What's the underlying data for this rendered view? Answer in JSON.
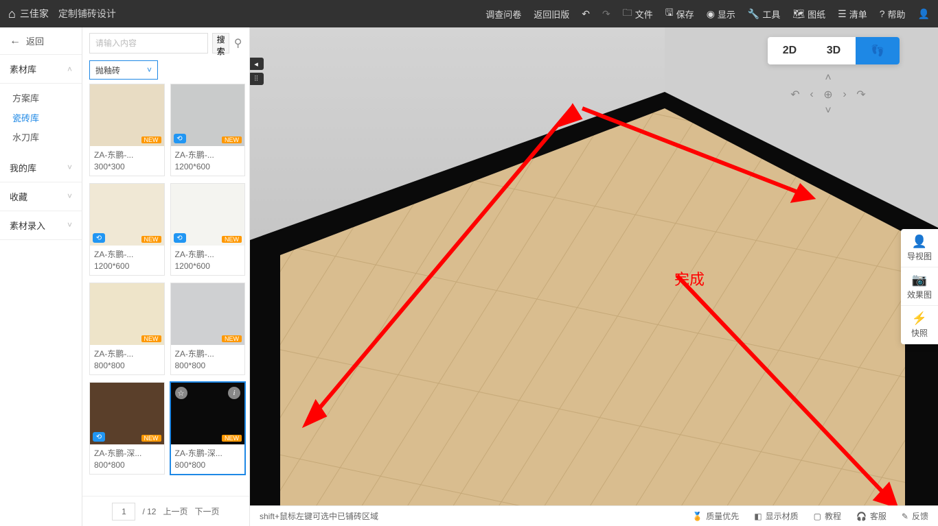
{
  "header": {
    "logo": "三佳家",
    "title": "定制铺砖设计",
    "menu": {
      "survey": "调查问卷",
      "back_old": "返回旧版",
      "file": "文件",
      "save": "保存",
      "display": "显示",
      "tools": "工具",
      "drawings": "图纸",
      "list": "清单",
      "help": "帮助"
    }
  },
  "left": {
    "back": "返回",
    "sections": {
      "material_lib": "素材库",
      "scheme_lib": "方案库",
      "tile_lib": "瓷砖库",
      "waterjet_lib": "水刀库",
      "my_lib": "我的库",
      "favorites": "收藏",
      "material_entry": "素材录入"
    }
  },
  "catalog": {
    "search_placeholder": "请输入内容",
    "search_btn": "搜索",
    "category": "抛釉砖",
    "new_badge": "NEW",
    "items": [
      {
        "name": "ZA-东鹏-...",
        "dim": "300*300",
        "bg": "#e8dcc3",
        "link": false
      },
      {
        "name": "ZA-东鹏-...",
        "dim": "1200*600",
        "bg": "#c9cbcb",
        "link": true
      },
      {
        "name": "ZA-东鹏-...",
        "dim": "1200*600",
        "bg": "#f0e8d5",
        "link": true
      },
      {
        "name": "ZA-东鹏-...",
        "dim": "1200*600",
        "bg": "#f4f4f0",
        "link": true
      },
      {
        "name": "ZA-东鹏-...",
        "dim": "800*800",
        "bg": "#eee4c9",
        "link": false
      },
      {
        "name": "ZA-东鹏-...",
        "dim": "800*800",
        "bg": "#cfd0d2",
        "link": false
      },
      {
        "name": "ZA-东鹏-深...",
        "dim": "800*800",
        "bg": "#5a3f2a",
        "link": true
      },
      {
        "name": "ZA-东鹏-深...",
        "dim": "800*800",
        "bg": "#0a0a0a",
        "link": false,
        "selected": true
      }
    ],
    "pager": {
      "page": "1",
      "total": "/ 12",
      "prev": "上一页",
      "next": "下一页"
    }
  },
  "viewport": {
    "modes": {
      "d2": "2D",
      "d3": "3D"
    },
    "complete": "完成",
    "right_tools": {
      "perspective": "导视图",
      "render": "效果图",
      "snapshot": "快照"
    }
  },
  "status": {
    "hint": "shift+鼠标左键可选中已铺砖区域",
    "quality": "质量优先",
    "show_mat": "显示材质",
    "tutorial": "教程",
    "service": "客服",
    "feedback": "反馈"
  }
}
